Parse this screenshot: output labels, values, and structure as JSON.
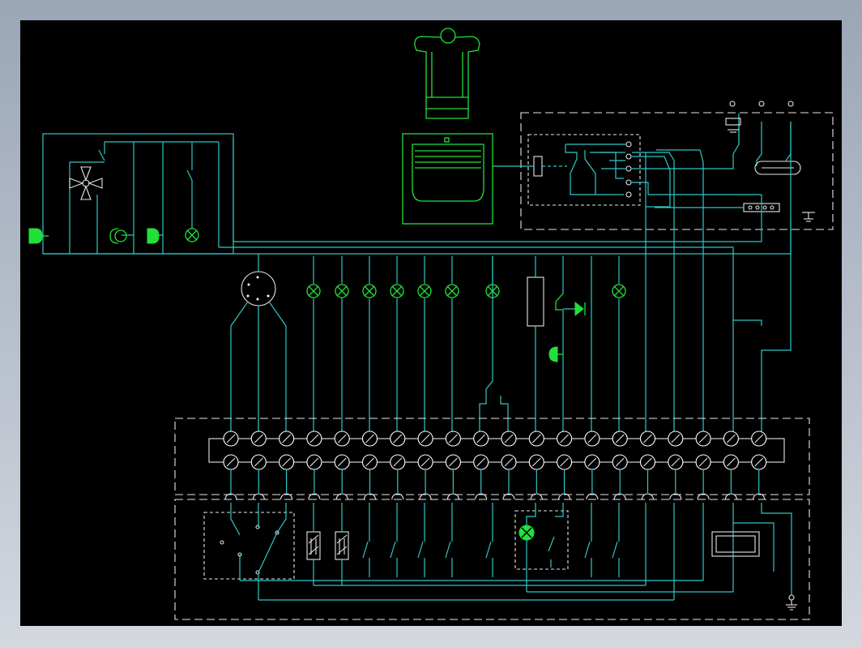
{
  "colors": {
    "background": "#000000",
    "frame": "#9aa6b6",
    "wire": "#2fc7c7",
    "component": "#22e03a",
    "border": "#e6e6e6"
  },
  "diagram": {
    "components": [
      "chef-hat-icon",
      "control-panel-display",
      "fan-motor",
      "buzzer",
      "indicator-lamp",
      "rotary-selector",
      "resistor",
      "push-button",
      "diode",
      "terminal-block",
      "ground-symbol",
      "transformer"
    ],
    "terminal_count": 20,
    "lamp_count": 9
  }
}
